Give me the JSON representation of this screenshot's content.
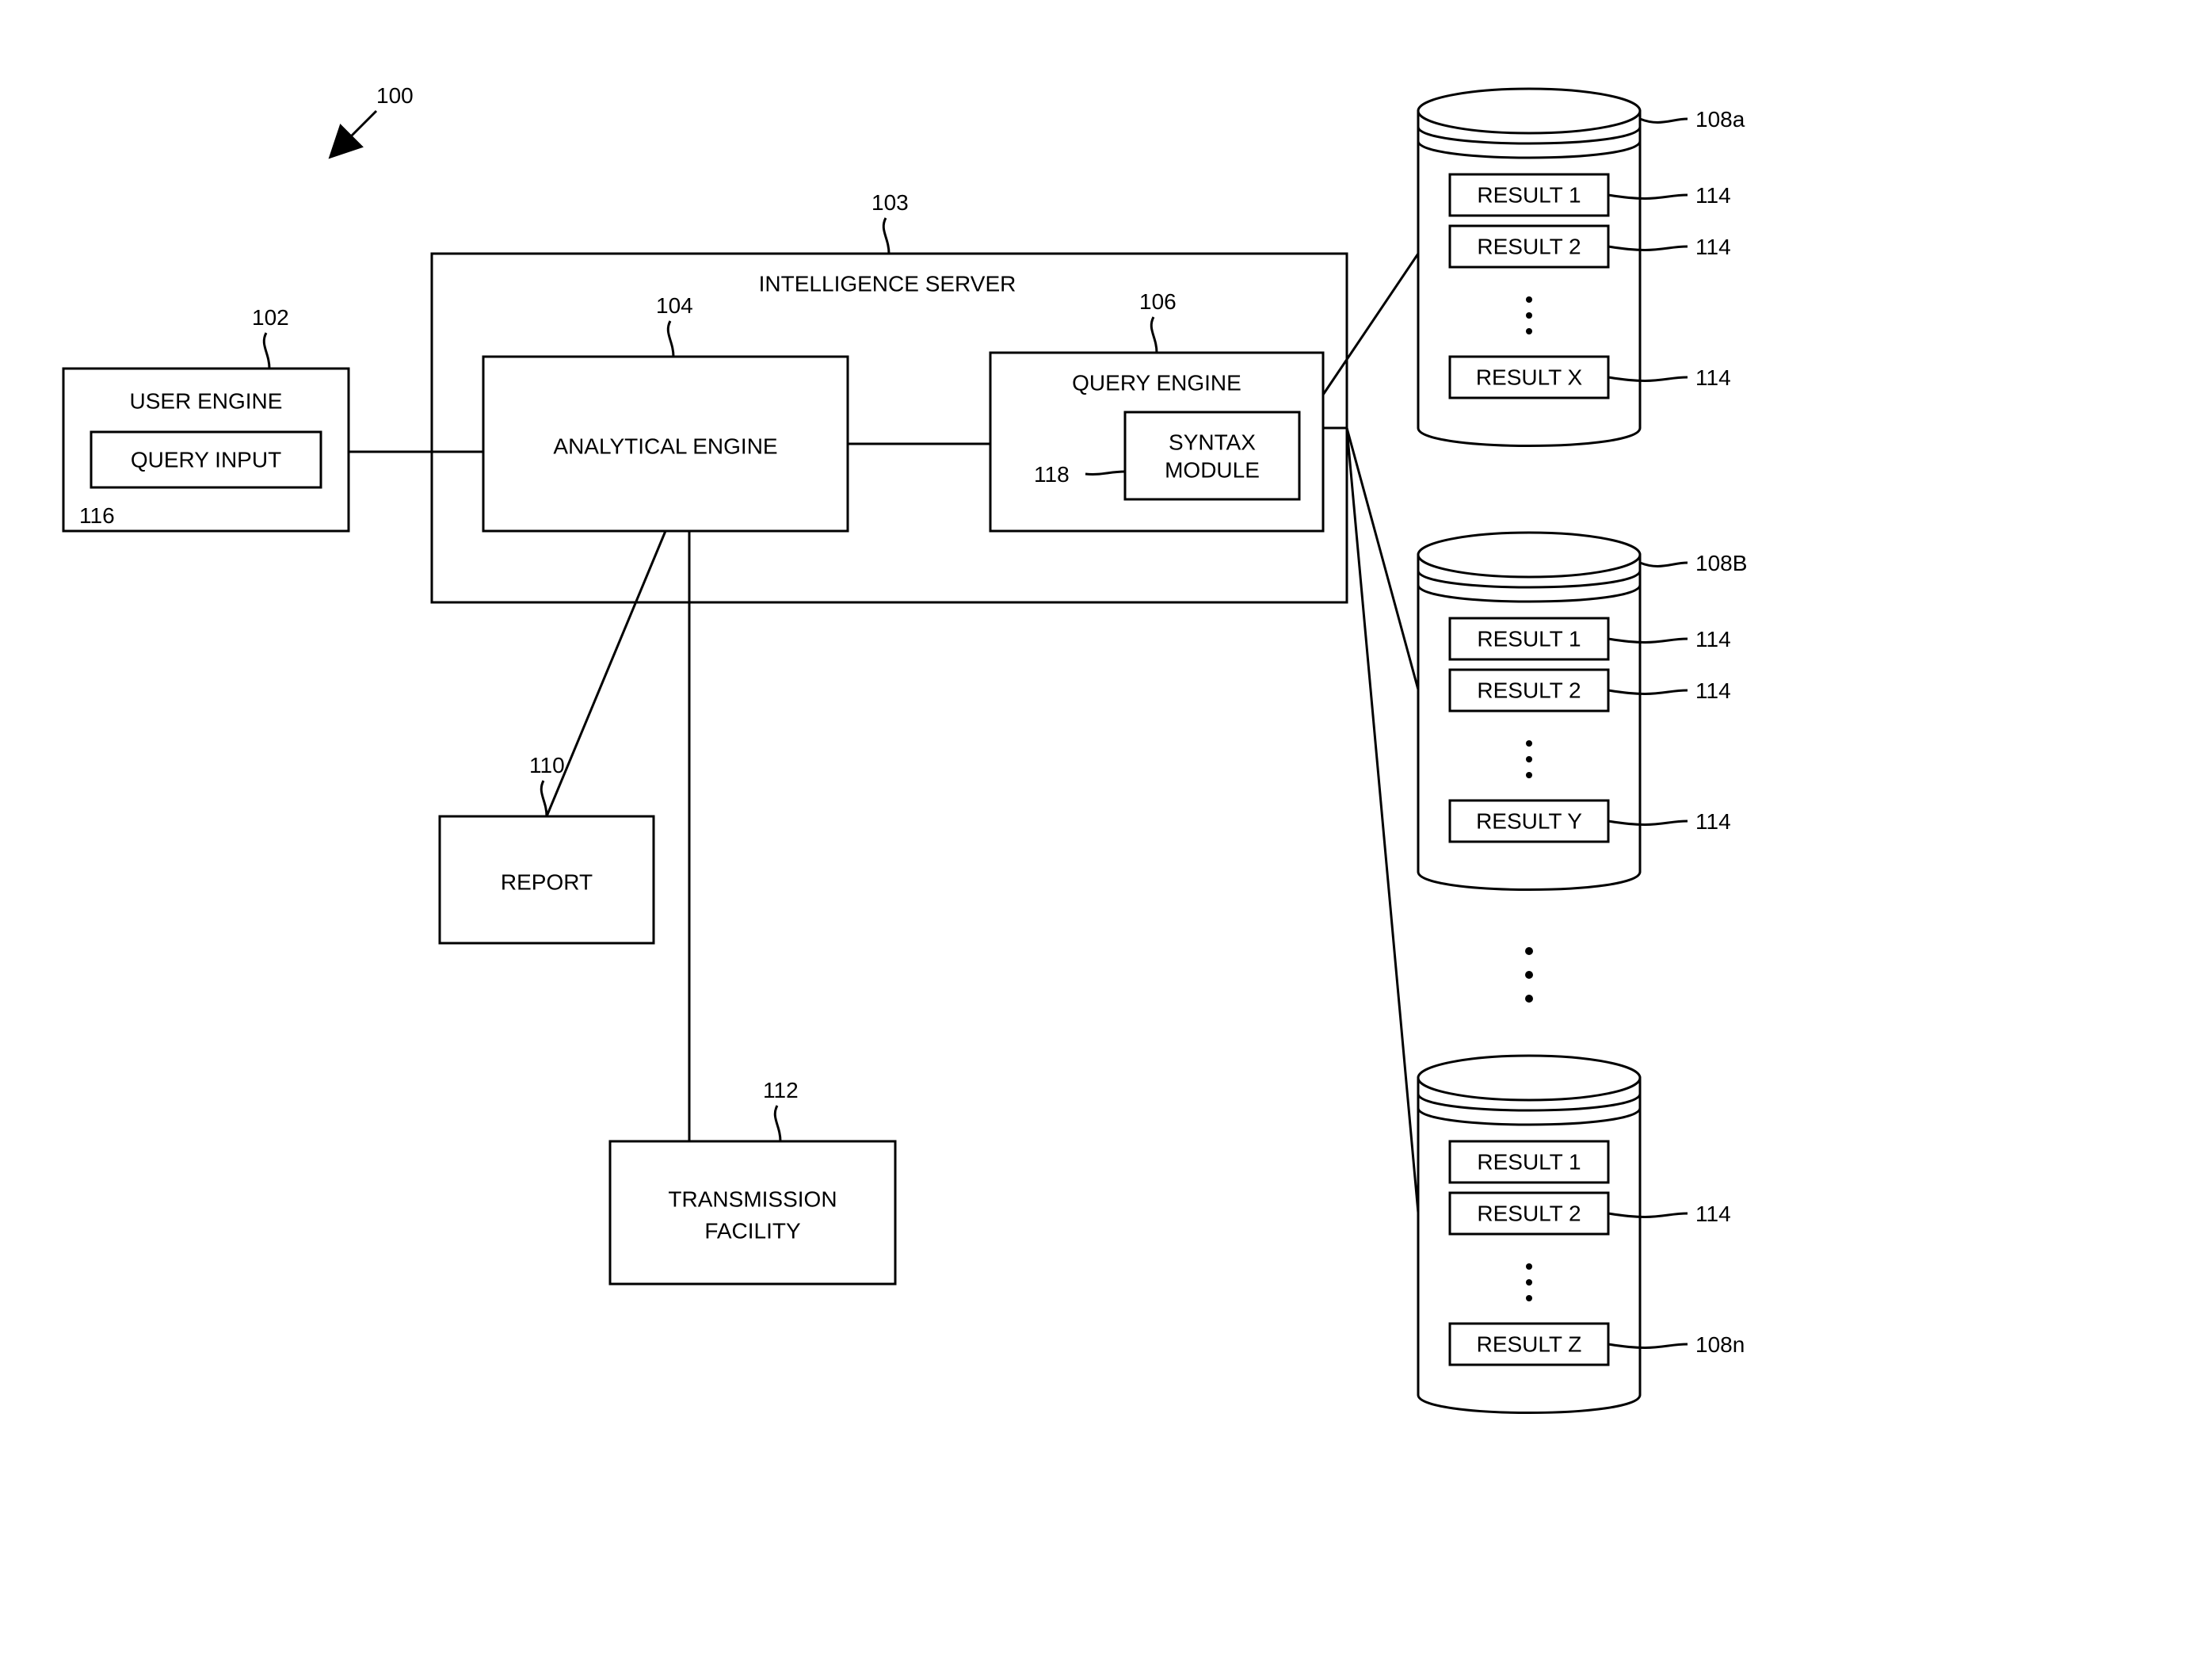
{
  "figureRef": "100",
  "userEngine": {
    "title": "USER ENGINE",
    "ref": "102",
    "inner": "QUERY INPUT",
    "innerRef": "116"
  },
  "server": {
    "title": "INTELLIGENCE SERVER",
    "ref": "103"
  },
  "analytical": {
    "title": "ANALYTICAL ENGINE",
    "ref": "104"
  },
  "queryEngine": {
    "title": "QUERY ENGINE",
    "ref": "106",
    "inner": "SYNTAX MODULE",
    "innerRef": "118"
  },
  "report": {
    "title": "REPORT",
    "ref": "110"
  },
  "transmission": {
    "title1": "TRANSMISSION",
    "title2": "FACILITY",
    "ref": "112"
  },
  "db": {
    "a": {
      "ref": "108a",
      "r1": "RESULT 1",
      "r2": "RESULT 2",
      "rN": "RESULT X",
      "cellRef": "114"
    },
    "b": {
      "ref": "108B",
      "r1": "RESULT 1",
      "r2": "RESULT 2",
      "rN": "RESULT Y",
      "cellRef": "114"
    },
    "n": {
      "ref": "108n",
      "r1": "RESULT 1",
      "r2": "RESULT 2",
      "rN": "RESULT Z",
      "cellRef": "114"
    }
  }
}
